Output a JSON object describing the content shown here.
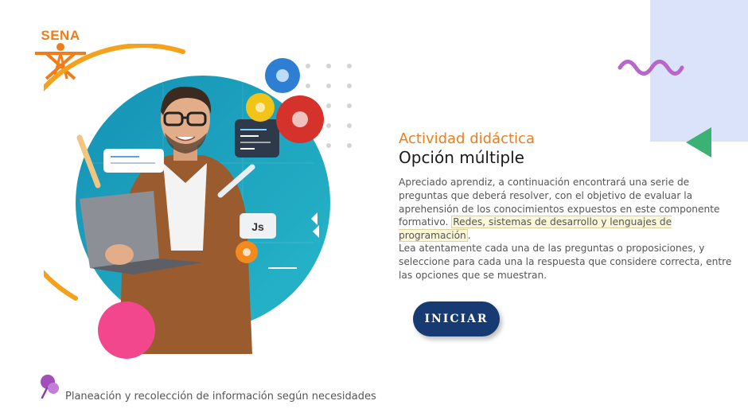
{
  "logo": {
    "text": "SENA",
    "icon": "sena-logo-icon"
  },
  "activity": {
    "kicker": "Actividad didáctica",
    "title": "Opción múltiple"
  },
  "description": {
    "p1_before": "Apreciado aprendiz, a continuación encontrará una serie de preguntas que deberá resolver, con el objetivo de evaluar la aprehensión de los conocimientos expuestos en este componente formativo.",
    "p1_highlight": "Redes, sistemas de desarrollo y lenguajes de programación",
    "p1_after": ".",
    "p2": "Lea atentamente cada una de las preguntas o proposiciones, y seleccione para cada una la respuesta que considere correcta, entre las opciones que se muestran."
  },
  "start_button": {
    "label": "INICIAR"
  },
  "footer": {
    "text": "Planeación y recolección de información según necesidades",
    "icon": "pushpin-icon"
  },
  "illustration": {
    "code_badge": "Js",
    "icons": [
      "gear-icon",
      "wrench-icon",
      "code-window-icon",
      "pencil-icon"
    ]
  },
  "colors": {
    "accent_orange": "#ef7d1c",
    "button_navy": "#173a72",
    "circle_teal": "#1e9fc0",
    "pink": "#f2468d",
    "purple_wave": "#b667c9",
    "green_triangle": "#3bb273",
    "lavender_block": "#dbe3fb"
  }
}
